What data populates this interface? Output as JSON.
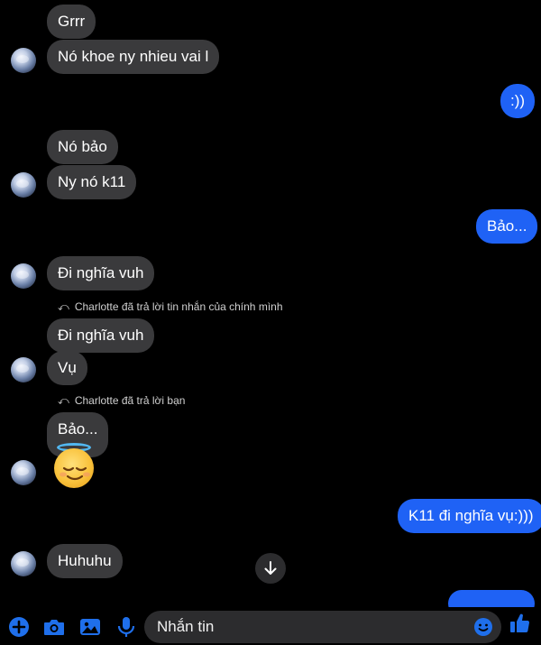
{
  "theme": {
    "incoming_bg": "#3a3a3c",
    "outgoing_bg": "#1f62f5",
    "accent": "#1f6feb",
    "background": "#000000"
  },
  "messages": {
    "m1": "Grrr",
    "m2": "Nó khoe ny nhieu vai l",
    "m3": ":))",
    "m4": "Nó bảo",
    "m5": "Ny nó k11",
    "m6": "Bảo...",
    "m7": "Đi nghĩa vuh",
    "m8": "Đi nghĩa vuh",
    "m9": "Vụ",
    "m10": "Bảo...",
    "m11": "K11 đi nghĩa vụ:)))",
    "m12": "Huhuhu"
  },
  "reply_notes": {
    "note1": "Charlotte đã trả lời tin nhắn của chính mình",
    "note2": "Charlotte đã trả lời bạn"
  },
  "composer": {
    "placeholder": "Nhắn tin"
  },
  "icons": [
    "plus-icon",
    "camera-icon",
    "image-icon",
    "microphone-icon",
    "emoji-icon",
    "thumbs-up-icon",
    "arrow-down-icon",
    "reply-icon"
  ]
}
